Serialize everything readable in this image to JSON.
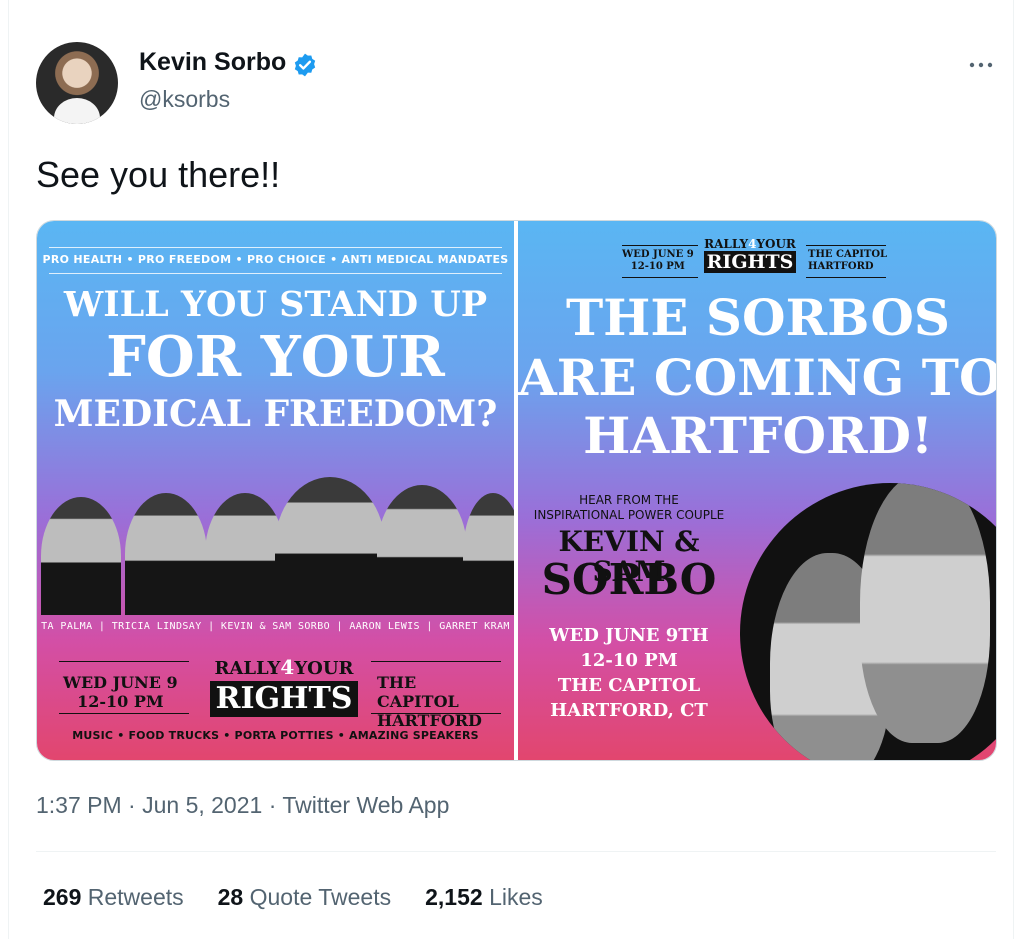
{
  "author": {
    "name": "Kevin Sorbo",
    "handle": "@ksorbs",
    "verified": true
  },
  "tweet_text": "See you there!!",
  "more_icon": "more-dots-icon",
  "image_left": {
    "tagline": "PRO HEALTH • PRO FREEDOM • PRO CHOICE • ANTI MEDICAL MANDATES",
    "headline_1": "WILL YOU STAND UP",
    "headline_2": "FOR YOUR",
    "headline_3": "MEDICAL FREEDOM?",
    "speakers": "TA PALMA | TRICIA LINDSAY | KEVIN & SAM SORBO | AARON LEWIS | GARRET KRAM",
    "date_line_1": "WED JUNE 9",
    "date_line_2": "12-10 PM",
    "rally_prefix": "RALLY",
    "rally_four": "4",
    "rally_suffix": "YOUR",
    "rally_rights": "RIGHTS",
    "place_line_1": "THE CAPITOL",
    "place_line_2": "HARTFORD",
    "footer": "MUSIC • FOOD TRUCKS • PORTA POTTIES • AMAZING SPEAKERS"
  },
  "image_right": {
    "date_line_1": "WED JUNE 9",
    "date_line_2": "12-10 PM",
    "rally_prefix": "RALLY",
    "rally_four": "4",
    "rally_suffix": "YOUR",
    "rally_rights": "RIGHTS",
    "place_line_1": "THE CAPITOL",
    "place_line_2": "HARTFORD",
    "headline_1": "THE SORBOS",
    "headline_2": "ARE COMING TO",
    "headline_3": "HARTFORD!",
    "hear_1": "HEAR FROM THE",
    "hear_2": "INSPIRATIONAL POWER COUPLE",
    "couple_1": "KEVIN & SAM",
    "couple_2": "SORBO",
    "info_1": "WED JUNE 9TH",
    "info_2": "12-10 PM",
    "info_3": "THE CAPITOL",
    "info_4": "HARTFORD, CT"
  },
  "meta": "1:37 PM · Jun 5, 2021 · Twitter Web App",
  "stats": {
    "retweets_count": "269",
    "retweets_label": "Retweets",
    "quotes_count": "28",
    "quotes_label": "Quote Tweets",
    "likes_count": "2,152",
    "likes_label": "Likes"
  },
  "colors": {
    "verified": "#1d9bf0",
    "secondary_text": "#536471"
  }
}
